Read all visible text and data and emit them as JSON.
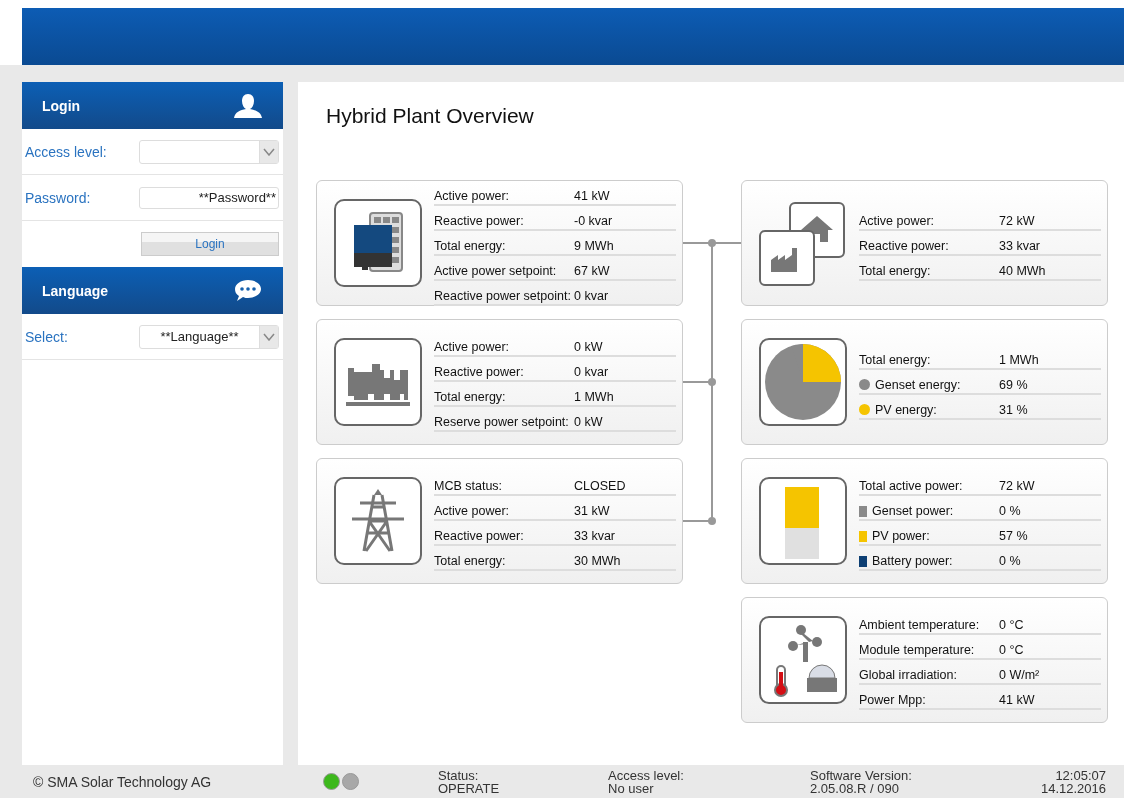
{
  "sidebar": {
    "login": {
      "title": "Login",
      "fields": [
        {
          "label": "Access level:",
          "kind": "select"
        },
        {
          "label": "Password:",
          "kind": "input",
          "placeholder": "**Password**"
        }
      ],
      "button": "Login"
    },
    "language": {
      "title": "Language",
      "fields": [
        {
          "label": "Select:",
          "kind": "select",
          "value": "**Language**"
        }
      ]
    }
  },
  "page_title": "Hybrid Plant Overview",
  "left_cards": [
    {
      "kind": "inverter",
      "rows": [
        {
          "label": "Active power:",
          "value": "41 kW"
        },
        {
          "label": "Reactive power:",
          "value": "-0 kvar"
        },
        {
          "label": "Total energy:",
          "value": "9 MWh"
        },
        {
          "label": "Active power setpoint:",
          "value": "67 kW"
        },
        {
          "label": "Reactive power setpoint:",
          "value": "0 kvar"
        }
      ]
    },
    {
      "kind": "genset",
      "rows": [
        {
          "label": "Active power:",
          "value": "0 kW"
        },
        {
          "label": "Reactive power:",
          "value": "0 kvar"
        },
        {
          "label": "Total energy:",
          "value": "1 MWh"
        },
        {
          "label": "Reserve power setpoint:",
          "value": "0 kW"
        }
      ]
    },
    {
      "kind": "grid",
      "rows": [
        {
          "label": "MCB status:",
          "value": "CLOSED"
        },
        {
          "label": "Active power:",
          "value": "31 kW"
        },
        {
          "label": "Reactive power:",
          "value": "33 kvar"
        },
        {
          "label": "Total energy:",
          "value": "30 MWh"
        }
      ]
    }
  ],
  "right_cards": [
    {
      "kind": "consumers",
      "rows": [
        {
          "label": "Active power:",
          "value": "72 kW"
        },
        {
          "label": "Reactive power:",
          "value": "33 kvar"
        },
        {
          "label": "Total energy:",
          "value": "40 MWh"
        }
      ]
    },
    {
      "kind": "pie",
      "rows": [
        {
          "label": "Total energy:",
          "value": "1 MWh"
        },
        {
          "label": "Genset energy:",
          "value": "69 %",
          "kind": "dot",
          "color": "#8a8a8a"
        },
        {
          "label": "PV energy:",
          "value": "31 %",
          "kind": "dot",
          "color": "#f5c400"
        }
      ]
    },
    {
      "kind": "bar",
      "rows": [
        {
          "label": "Total active power:",
          "value": "72 kW"
        },
        {
          "label": "Genset power:",
          "value": "0 %",
          "kind": "square",
          "color": "#8a8a8a"
        },
        {
          "label": "PV power:",
          "value": "57 %",
          "kind": "square",
          "color": "#f5c400"
        },
        {
          "label": "Battery power:",
          "value": "0 %",
          "kind": "square",
          "color": "#0d3f73"
        }
      ]
    },
    {
      "kind": "weather",
      "rows": [
        {
          "label": "Ambient temperature:",
          "value": "0 °C"
        },
        {
          "label": "Module temperature:",
          "value": "0 °C"
        },
        {
          "label": "Global irradiation:",
          "value": "0 W/m²"
        },
        {
          "label": "Power Mpp:",
          "value": "41 kW"
        }
      ]
    }
  ],
  "status_bar": {
    "copyright": "© SMA Solar Technology AG",
    "lights": [
      {
        "color": "#3db81c"
      },
      {
        "color": "#a8a8a8"
      }
    ],
    "items": [
      {
        "label": "Status:",
        "value": "OPERATE"
      },
      {
        "label": "Access level:",
        "value": "No user"
      },
      {
        "label": "Software Version:",
        "value": "2.05.08.R / 090"
      }
    ],
    "time": "12:05:07",
    "date": "14.12.2016"
  }
}
